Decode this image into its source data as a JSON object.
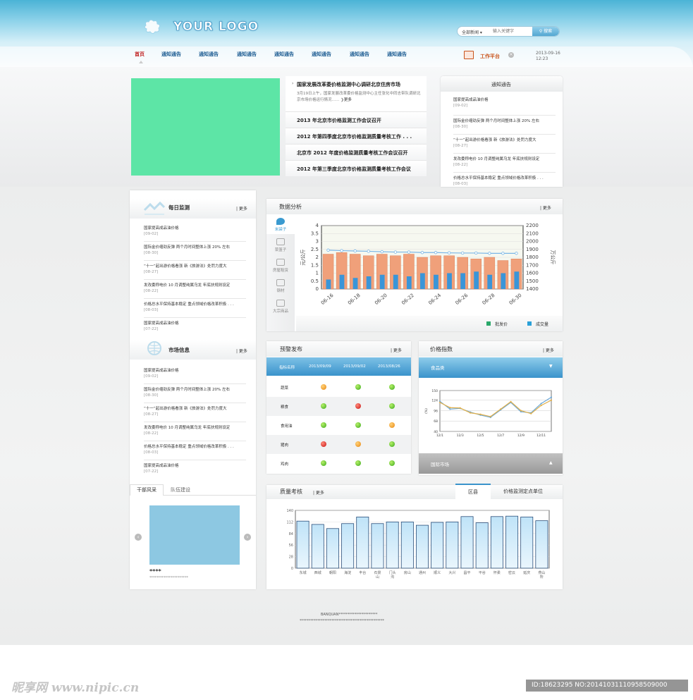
{
  "header": {
    "logo": "YOUR LOGO",
    "search": {
      "category": "全部新闻",
      "placeholder": "输入关键字",
      "button": "搜索"
    },
    "nav": [
      "首页",
      "通知通告",
      "通知通告",
      "通知通告",
      "通知通告",
      "通知通告",
      "通知通告",
      "通知通告"
    ],
    "work_platform": "工作平台",
    "close": "×",
    "date": "2013-09-16",
    "time": "12:23"
  },
  "top_news": {
    "headline": "国家发展改革委价格监测中心调研北京住房市场",
    "headline_desc": "3月19日上午，国家发展改革委价格监测中心主任张化中同志带队调研北京市场价格运行情况……",
    "headline_more": "更多",
    "items": [
      "2013 年北京市价格监测工作会议召开",
      "2012 年第四季度北京市价格监测质量考核工作 . . .",
      "北京市 2012 年度价格监测质量考核工作会议召开",
      "2012 年第三季度北京市价格监测质量考核工作会议"
    ]
  },
  "notice": {
    "title": "通知通告",
    "items": [
      {
        "text": "国家提高成品油价格",
        "date": "[09-02]"
      },
      {
        "text": "国际金价缩劲反弹 两个月时间整体上涨 20% 左右",
        "date": "[08-30]"
      },
      {
        "text": "“十一”起出游价格看涨 新《旅游法》处罚力度大",
        "date": "[08-27]"
      },
      {
        "text": "发改委称电价 10 月调整纯属乌龙 年底扶规则设定",
        "date": "[08-22]"
      },
      {
        "text": "价格总水平保持基本稳定 重点领域价格改革积极 . . .",
        "date": "[08-03]"
      }
    ]
  },
  "left": {
    "daily": {
      "title": "每日监测",
      "more": "| 更多",
      "items": [
        {
          "text": "国家提高成品油价格",
          "date": "[09-02]"
        },
        {
          "text": "国际金价缩劲反弹 两个月时间整体上涨 20% 左右",
          "date": "[08-30]"
        },
        {
          "text": "“十一”起出游价格看涨 新《旅游法》处罚力度大",
          "date": "[08-27]"
        },
        {
          "text": "发改委称电价 10 月调整纯属乌龙 年底扶规则设定",
          "date": "[08-22]"
        },
        {
          "text": "价格总水平保持基本稳定 重点领域价格改革积极 . . .",
          "date": "[08-03]"
        },
        {
          "text": "国家提高成品油价格",
          "date": "[07-22]"
        }
      ]
    },
    "market": {
      "title": "市场信息",
      "more": "| 更多",
      "items": [
        {
          "text": "国家提高成品油价格",
          "date": "[09-02]"
        },
        {
          "text": "国际金价缩劲反弹 两个月时间整体上涨 20% 左右",
          "date": "[08-30]"
        },
        {
          "text": "“十一”起出游价格看涨 新《旅游法》处罚力度大",
          "date": "[08-27]"
        },
        {
          "text": "发改委称电价 10 月调整纯属乌龙 年底扶规则设定",
          "date": "[08-22]"
        },
        {
          "text": "价格总水平保持基本稳定 重点领域价格改革积极 . . .",
          "date": "[08-03]"
        },
        {
          "text": "国家提高成品油价格",
          "date": "[07-22]"
        }
      ]
    },
    "tabs": [
      "干部风采",
      "队伍建设"
    ],
    "caption": "****",
    "subcaption": "**********************"
  },
  "data_analysis": {
    "title": "数据分析",
    "more": "| 更多",
    "side": [
      "米袋子",
      "菜篮子",
      "房屋租赁",
      "钢材",
      "大宗商品"
    ],
    "legend": [
      "批发价",
      "成交量"
    ]
  },
  "alert": {
    "title": "预警发布",
    "more": "| 更多",
    "headers": [
      "指标名称",
      "2013/09/09",
      "2013/09/02",
      "2013/08/26"
    ],
    "rows": [
      {
        "name": "蔬菜",
        "status": [
          "o",
          "g",
          "g"
        ]
      },
      {
        "name": "粮食",
        "status": [
          "g",
          "r",
          "g"
        ]
      },
      {
        "name": "食用油",
        "status": [
          "g",
          "g",
          "o"
        ]
      },
      {
        "name": "猪肉",
        "status": [
          "r",
          "o",
          "g"
        ]
      },
      {
        "name": "鸡肉",
        "status": [
          "g",
          "g",
          "g"
        ]
      }
    ]
  },
  "price_index": {
    "title": "价格指数",
    "more": "| 更多",
    "food": "食品类",
    "international": "国际市场",
    "caret_down": "▼",
    "caret_up": "▲"
  },
  "quality": {
    "title": "质量考核",
    "more": "| 更多",
    "tabs": [
      "区县",
      "价格监测定点单位"
    ]
  },
  "footer": {
    "line1": "BANQUAN**********************",
    "line2": "************************************************"
  },
  "watermark": {
    "left": "昵享网 www.nipic.cn",
    "right": "ID:18623295 NO:20141031110958509000"
  },
  "chart_data": [
    {
      "type": "bar",
      "title": "",
      "categories": [
        "06-16",
        "06-17",
        "06-18",
        "06-19",
        "06-20",
        "06-21",
        "06-22",
        "06-23",
        "06-24",
        "06-25",
        "06-26",
        "06-27",
        "06-28",
        "06-29",
        "06-30"
      ],
      "x_tick_labels": [
        "06-16",
        "06-18",
        "06-20",
        "06-22",
        "06-24",
        "06-26",
        "06-28",
        "06-30"
      ],
      "ylabel": "元/公斤",
      "y2label": "万公斤",
      "ylim": [
        0,
        4
      ],
      "y2lim": [
        1400,
        2200
      ],
      "yticks": [
        "0",
        "0.5",
        "1",
        "1.5",
        "2",
        "2.5",
        "3",
        "3.5",
        "4"
      ],
      "y2ticks": [
        "1400",
        "1500",
        "1600",
        "1700",
        "1800",
        "1900",
        "2000",
        "2100",
        "2200"
      ],
      "series": [
        {
          "name": "批发价",
          "type": "bar",
          "axis": "left",
          "values": [
            2.2,
            2.3,
            2.2,
            2.1,
            2.2,
            2.1,
            2.2,
            2.0,
            2.1,
            2.1,
            2.0,
            1.9,
            2.0,
            1.8,
            1.9
          ],
          "color": "#f0a07a"
        },
        {
          "name": "成交量",
          "type": "bar",
          "axis": "left",
          "values": [
            0.6,
            0.9,
            0.7,
            0.8,
            0.9,
            0.9,
            0.8,
            1.0,
            0.9,
            1.0,
            1.0,
            1.1,
            0.9,
            1.0,
            1.1
          ],
          "color": "#3a95d8"
        },
        {
          "type": "line",
          "axis": "left",
          "values": [
            2.45,
            2.42,
            2.4,
            2.38,
            2.35,
            2.33,
            2.33,
            2.3,
            2.3,
            2.28,
            2.27,
            2.27,
            2.25,
            2.25,
            2.25
          ],
          "color": "#7ab6e6"
        }
      ],
      "grid": true
    },
    {
      "type": "line",
      "title": "",
      "ylabel": "(%)",
      "categories": [
        "12/1",
        "12/2",
        "12/3",
        "12/4",
        "12/5",
        "12/6",
        "12/7",
        "12/8",
        "12/9",
        "12/10",
        "12/11",
        "12/12"
      ],
      "x_tick_labels": [
        "12/1",
        "12/3",
        "12/5",
        "12/7",
        "12/9",
        "12/11"
      ],
      "ylim": [
        40,
        150
      ],
      "yticks": [
        "40",
        "68",
        "96",
        "124",
        "150"
      ],
      "series": [
        {
          "values": [
            121,
            100,
            102,
            92,
            84,
            78,
            98,
            118,
            93,
            90,
            115,
            132
          ],
          "color": "#6ba8d8"
        },
        {
          "values": [
            118,
            104,
            103,
            90,
            86,
            80,
            100,
            120,
            96,
            88,
            110,
            124
          ],
          "color": "#e2b04a"
        }
      ],
      "grid": true
    },
    {
      "type": "bar",
      "title": "",
      "categories": [
        "东城",
        "西城",
        "朝阳",
        "海淀",
        "丰台",
        "石景山",
        "门头沟",
        "房山",
        "通州",
        "顺义",
        "大兴",
        "昌平",
        "平谷",
        "怀柔",
        "密云",
        "延庆",
        "燕山所"
      ],
      "ylim": [
        0,
        140
      ],
      "yticks": [
        "0",
        "28",
        "56",
        "84",
        "112",
        "140"
      ],
      "values": [
        114,
        106,
        96,
        108,
        124,
        108,
        112,
        112,
        104,
        111,
        112,
        125,
        110,
        125,
        126,
        124,
        115
      ],
      "grid": true
    }
  ]
}
